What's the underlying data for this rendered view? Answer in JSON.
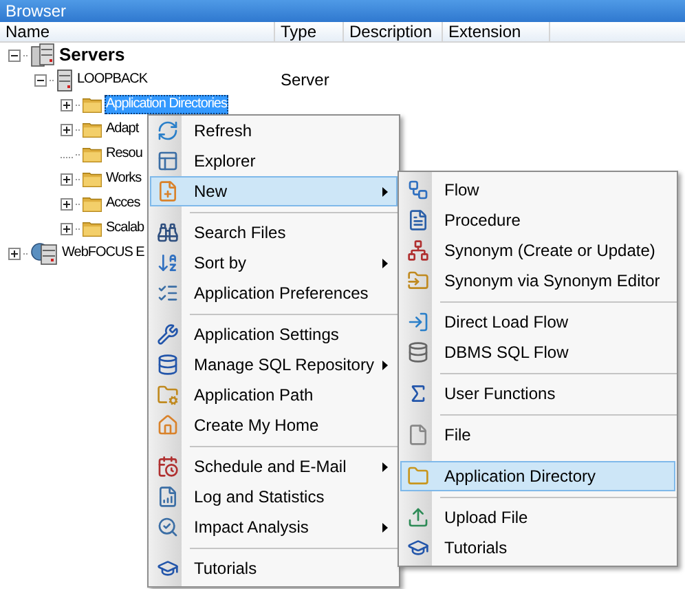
{
  "window": {
    "title": "Browser"
  },
  "columns": [
    "Name",
    "Type",
    "Description",
    "Extension"
  ],
  "tree": [
    {
      "label": "Servers",
      "kind": "servers",
      "bold": true,
      "expanded": true,
      "children": [
        {
          "label": "LOOPBACK",
          "kind": "server",
          "type": "Server",
          "expanded": true,
          "children": [
            {
              "label": "Application Directories",
              "kind": "folder",
              "expanded": false,
              "selected": true
            },
            {
              "label": "Adapt",
              "kind": "folder",
              "expanded": false,
              "selected": false
            },
            {
              "label": "Resou",
              "kind": "folder",
              "selected": false
            },
            {
              "label": "Works",
              "kind": "folder",
              "expanded": false,
              "selected": false
            },
            {
              "label": "Acces",
              "kind": "folder",
              "expanded": false,
              "selected": false
            },
            {
              "label": "Scalab",
              "kind": "folder",
              "expanded": false,
              "selected": false
            }
          ]
        }
      ]
    },
    {
      "label": "WebFOCUS E",
      "kind": "globe-server",
      "expanded": false
    }
  ],
  "context_menu": [
    {
      "kind": "item",
      "label": "Refresh",
      "submenu": false,
      "selected": false
    },
    {
      "kind": "item",
      "label": "Explorer",
      "submenu": false,
      "selected": false
    },
    {
      "kind": "item",
      "label": "New",
      "submenu": true,
      "selected": true
    },
    {
      "kind": "separator"
    },
    {
      "kind": "item",
      "label": "Search Files",
      "submenu": false,
      "selected": false
    },
    {
      "kind": "item",
      "label": "Sort by",
      "submenu": true,
      "selected": false
    },
    {
      "kind": "item",
      "label": "Application Preferences",
      "submenu": false,
      "selected": false
    },
    {
      "kind": "separator"
    },
    {
      "kind": "item",
      "label": "Application Settings",
      "submenu": false,
      "selected": false
    },
    {
      "kind": "item",
      "label": "Manage SQL Repository",
      "submenu": true,
      "selected": false
    },
    {
      "kind": "item",
      "label": "Application Path",
      "submenu": false,
      "selected": false
    },
    {
      "kind": "item",
      "label": "Create My Home",
      "submenu": false,
      "selected": false
    },
    {
      "kind": "separator"
    },
    {
      "kind": "item",
      "label": "Schedule and E-Mail",
      "submenu": true,
      "selected": false
    },
    {
      "kind": "item",
      "label": "Log and Statistics",
      "submenu": false,
      "selected": false
    },
    {
      "kind": "item",
      "label": "Impact Analysis",
      "submenu": true,
      "selected": false
    },
    {
      "kind": "separator"
    },
    {
      "kind": "item",
      "label": "Tutorials",
      "submenu": false,
      "selected": false
    }
  ],
  "new_submenu": [
    {
      "kind": "item",
      "label": "Flow",
      "selected": false
    },
    {
      "kind": "item",
      "label": "Procedure",
      "selected": false
    },
    {
      "kind": "item",
      "label": "Synonym (Create or Update)",
      "selected": false
    },
    {
      "kind": "item",
      "label": "Synonym via Synonym Editor",
      "selected": false
    },
    {
      "kind": "separator"
    },
    {
      "kind": "item",
      "label": "Direct Load Flow",
      "selected": false
    },
    {
      "kind": "item",
      "label": "DBMS SQL Flow",
      "selected": false
    },
    {
      "kind": "separator"
    },
    {
      "kind": "item",
      "label": "User Functions",
      "selected": false
    },
    {
      "kind": "separator"
    },
    {
      "kind": "item",
      "label": "File",
      "selected": false
    },
    {
      "kind": "gap"
    },
    {
      "kind": "item",
      "label": "Application Directory",
      "selected": true
    },
    {
      "kind": "separator"
    },
    {
      "kind": "item",
      "label": "Upload File",
      "selected": false
    },
    {
      "kind": "item",
      "label": "Tutorials",
      "selected": false
    }
  ]
}
